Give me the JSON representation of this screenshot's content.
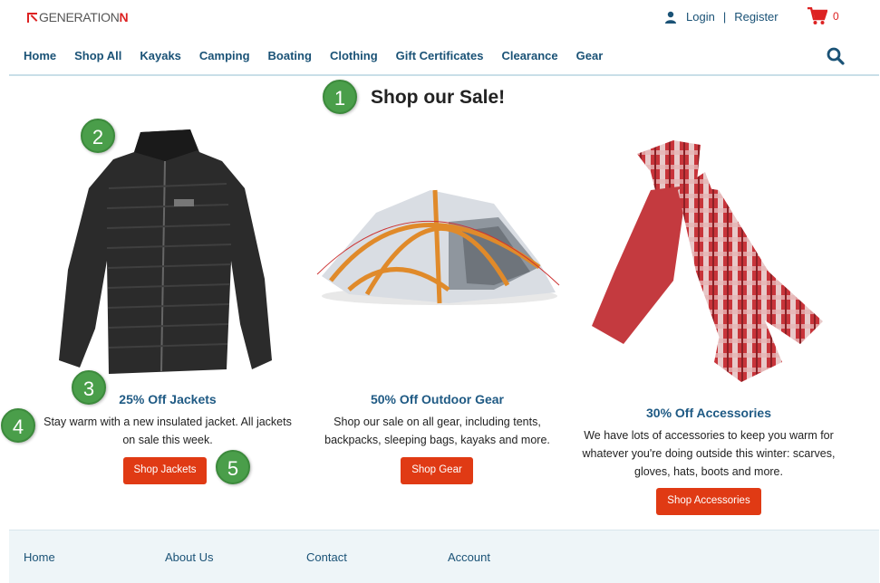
{
  "header": {
    "logo_prefix": "GENERATION",
    "logo_suffix": "N",
    "login": "Login",
    "separator": "|",
    "register": "Register",
    "cart_count": "0"
  },
  "nav": {
    "items": [
      "Home",
      "Shop All",
      "Kayaks",
      "Camping",
      "Boating",
      "Clothing",
      "Gift Certificates",
      "Clearance",
      "Gear"
    ]
  },
  "main": {
    "title": "Shop our Sale!",
    "promos": [
      {
        "title": "25% Off Jackets",
        "text": "Stay warm with a new insulated jacket. All jackets on sale this week.",
        "button": "Shop Jackets"
      },
      {
        "title": "50% Off Outdoor Gear",
        "text": "Shop our sale on all gear, including tents, backpacks, sleeping bags, kayaks and more.",
        "button": "Shop Gear"
      },
      {
        "title": "30% Off Accessories",
        "text": "We have lots of accessories to keep you warm for whatever you're doing outside this winter: scarves, gloves, hats, boots and more.",
        "button": "Shop Accessories"
      }
    ]
  },
  "annotations": [
    "1",
    "2",
    "3",
    "4",
    "5"
  ],
  "footer": {
    "links": [
      "Home",
      "About Us",
      "Contact",
      "Account"
    ]
  },
  "colors": {
    "brand_red": "#d22222",
    "button": "#e03a14",
    "link_blue": "#1a5276",
    "badge_green": "#4a9e4a"
  }
}
